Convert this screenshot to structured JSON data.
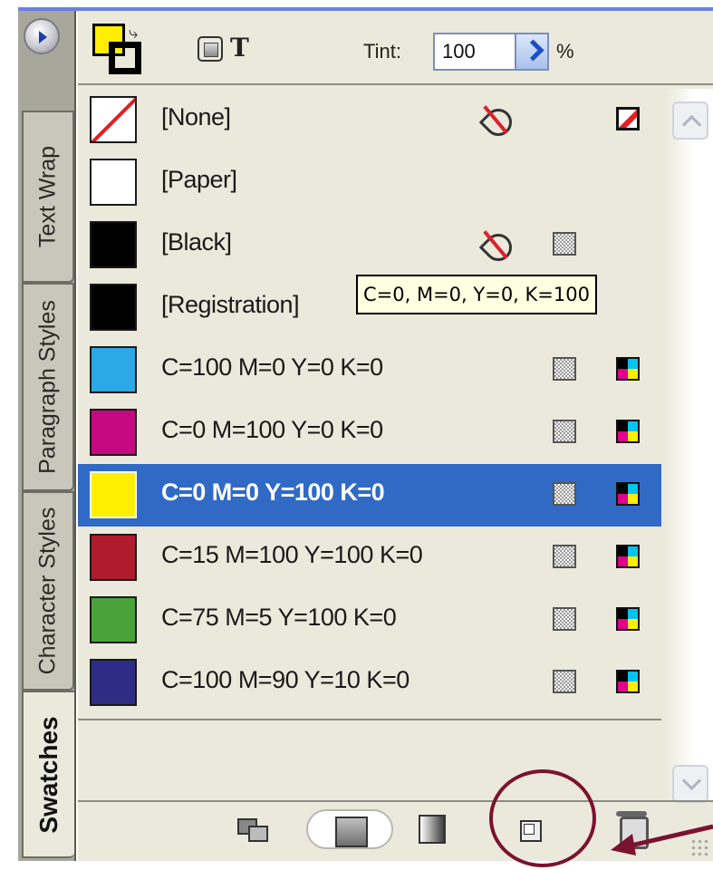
{
  "panel": {
    "tabs": [
      "Text Wrap",
      "Paragraph Styles",
      "Character Styles",
      "Swatches"
    ],
    "active_tab": "Swatches"
  },
  "toolbar": {
    "formatting_text_label": "T",
    "tint_label": "Tint:",
    "tint_value": "100",
    "percent_label": "%",
    "fill_color": "#ffee00",
    "stroke_color": "#000000"
  },
  "swatches": [
    {
      "name": "[None]",
      "color": "none",
      "no_edit_icon": true,
      "mode_icon": "none-mode-icon"
    },
    {
      "name": "[Paper]",
      "color": "#ffffff"
    },
    {
      "name": "[Black]",
      "color": "#000000",
      "no_edit_icon": true,
      "mode_icon": "process-icon"
    },
    {
      "name": "[Registration]",
      "color": "#000000"
    },
    {
      "name": "C=100 M=0 Y=0 K=0",
      "color": "#2ba8e6",
      "mode_icon": "process-icon",
      "type_icon": "cmyk-icon"
    },
    {
      "name": "C=0 M=100 Y=0 K=0",
      "color": "#c4087f",
      "mode_icon": "process-icon",
      "type_icon": "cmyk-icon"
    },
    {
      "name": "C=0 M=0 Y=100 K=0",
      "color": "#ffee00",
      "mode_icon": "process-icon",
      "type_icon": "cmyk-icon",
      "selected": true
    },
    {
      "name": "C=15 M=100 Y=100 K=0",
      "color": "#b01b2e",
      "mode_icon": "process-icon",
      "type_icon": "cmyk-icon"
    },
    {
      "name": "C=75 M=5 Y=100 K=0",
      "color": "#4aa23a",
      "mode_icon": "process-icon",
      "type_icon": "cmyk-icon"
    },
    {
      "name": "C=100 M=90 Y=10 K=0",
      "color": "#2e2d85",
      "mode_icon": "process-icon",
      "type_icon": "cmyk-icon"
    }
  ],
  "tooltip": "C=0, M=0, Y=0, K=100",
  "bottom_bar": {
    "icons": [
      "show-all-swatches-icon",
      "show-color-swatches-icon",
      "show-gradient-swatches-icon",
      "new-swatch-icon",
      "delete-swatch-icon"
    ]
  },
  "colors": {
    "selection": "#316ac5",
    "panel_bg": "#ebe9dc",
    "annotation": "#7a1230"
  }
}
